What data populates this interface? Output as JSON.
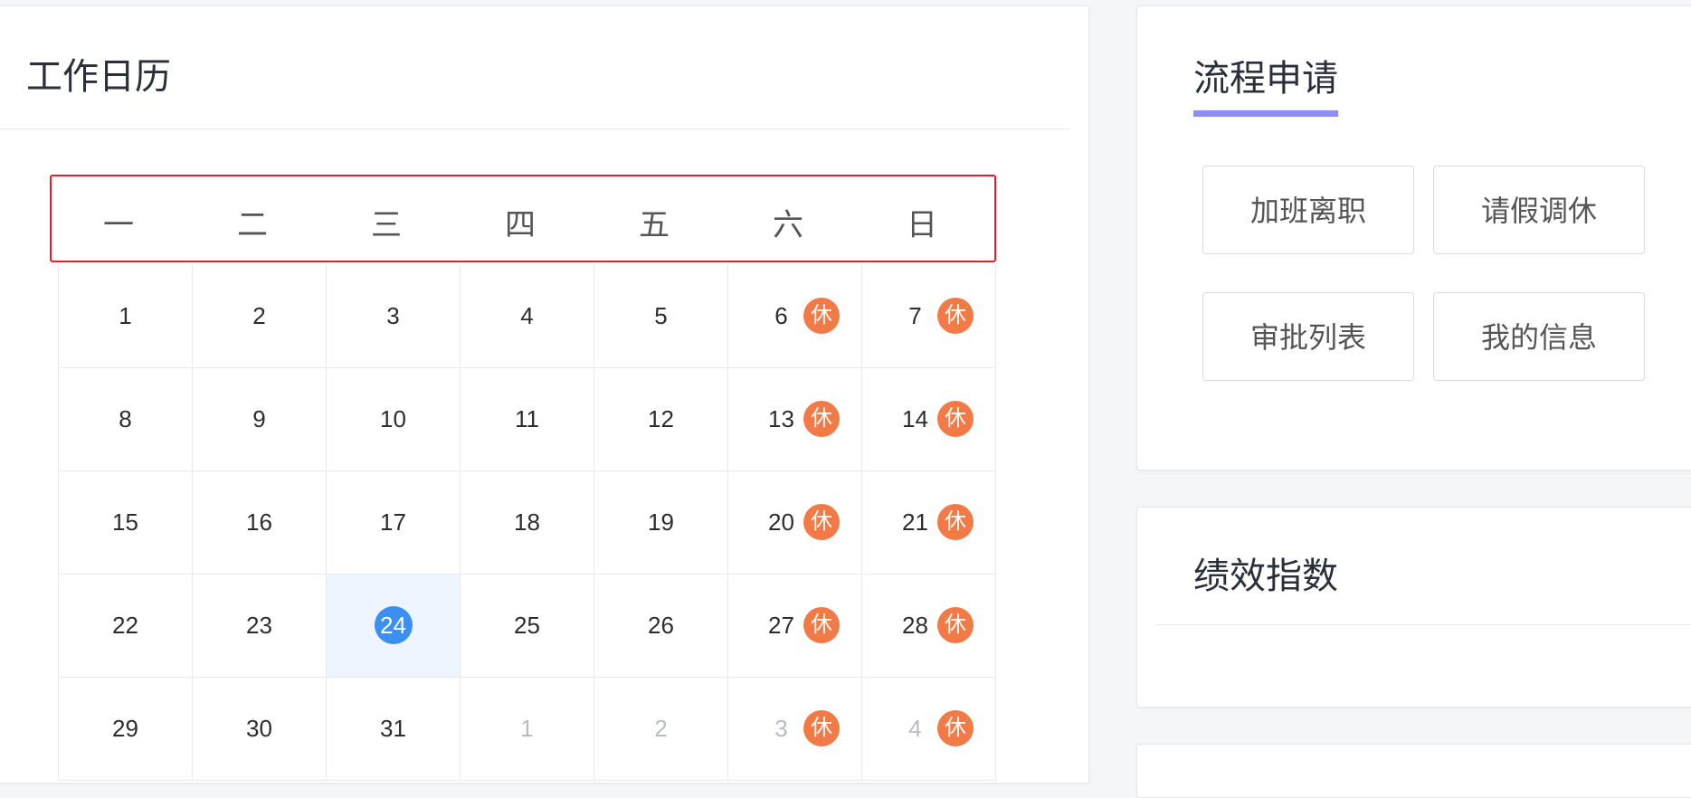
{
  "calendar": {
    "title": "工作日历",
    "weekdays": [
      "一",
      "二",
      "三",
      "四",
      "五",
      "六",
      "日"
    ],
    "rest_label": "休",
    "today": 24,
    "weeks": [
      [
        {
          "d": "1"
        },
        {
          "d": "2"
        },
        {
          "d": "3"
        },
        {
          "d": "4"
        },
        {
          "d": "5"
        },
        {
          "d": "6",
          "rest": true
        },
        {
          "d": "7",
          "rest": true
        }
      ],
      [
        {
          "d": "8"
        },
        {
          "d": "9"
        },
        {
          "d": "10"
        },
        {
          "d": "11"
        },
        {
          "d": "12"
        },
        {
          "d": "13",
          "rest": true
        },
        {
          "d": "14",
          "rest": true
        }
      ],
      [
        {
          "d": "15"
        },
        {
          "d": "16"
        },
        {
          "d": "17"
        },
        {
          "d": "18"
        },
        {
          "d": "19"
        },
        {
          "d": "20",
          "rest": true
        },
        {
          "d": "21",
          "rest": true
        }
      ],
      [
        {
          "d": "22"
        },
        {
          "d": "23"
        },
        {
          "d": "24",
          "today": true
        },
        {
          "d": "25"
        },
        {
          "d": "26"
        },
        {
          "d": "27",
          "rest": true
        },
        {
          "d": "28",
          "rest": true
        }
      ],
      [
        {
          "d": "29"
        },
        {
          "d": "30"
        },
        {
          "d": "31"
        },
        {
          "d": "1",
          "other": true
        },
        {
          "d": "2",
          "other": true
        },
        {
          "d": "3",
          "other": true,
          "rest": true
        },
        {
          "d": "4",
          "other": true,
          "rest": true
        }
      ]
    ]
  },
  "process": {
    "title": "流程申请",
    "accent_color": "#8c8ef0",
    "buttons": [
      "加班离职",
      "请假调休",
      "审批列表",
      "我的信息"
    ]
  },
  "performance": {
    "title": "绩效指数"
  },
  "colors": {
    "rest_badge": "#f27a46",
    "today_dot": "#3b8ff0",
    "today_bg": "#eef5ff",
    "weekday_frame": "#e0202c"
  }
}
